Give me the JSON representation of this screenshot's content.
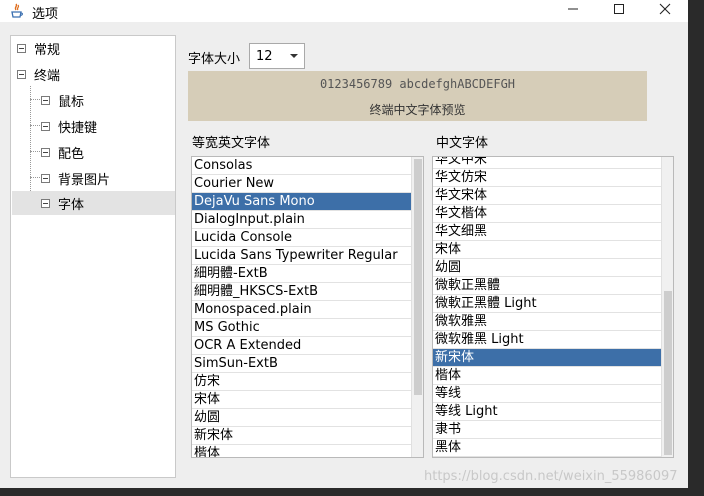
{
  "window": {
    "title": "选项"
  },
  "tree": {
    "items": [
      {
        "label": "常规"
      },
      {
        "label": "终端"
      },
      {
        "label": "鼠标"
      },
      {
        "label": "快捷键"
      },
      {
        "label": "配色"
      },
      {
        "label": "背景图片"
      },
      {
        "label": "字体"
      }
    ],
    "selected": "字体"
  },
  "font_size": {
    "label": "字体大小",
    "value": "12"
  },
  "preview": {
    "line1": "0123456789 abcdefghABCDEFGH",
    "line2": "终端中文字体预览"
  },
  "mono_fonts": {
    "label": "等宽英文字体",
    "selected": "DejaVu Sans Mono",
    "items": [
      "Consolas",
      "Courier New",
      "DejaVu Sans Mono",
      "DialogInput.plain",
      "Lucida Console",
      "Lucida Sans Typewriter Regular",
      "細明體-ExtB",
      "細明體_HKSCS-ExtB",
      "Monospaced.plain",
      "MS Gothic",
      "OCR A Extended",
      "SimSun-ExtB",
      "仿宋",
      "宋体",
      "幼圆",
      "新宋体",
      "楷体"
    ]
  },
  "cn_fonts": {
    "label": "中文字体",
    "selected": "新宋体",
    "items": [
      "华文中宋",
      "华文仿宋",
      "华文宋体",
      "华文楷体",
      "华文细黑",
      "宋体",
      "幼圆",
      "微軟正黑體",
      "微軟正黑體 Light",
      "微软雅黑",
      "微软雅黑 Light",
      "新宋体",
      "楷体",
      "等线",
      "等线 Light",
      "隶书",
      "黑体"
    ]
  },
  "watermark": "https://blog.csdn.net/weixin_55986097"
}
